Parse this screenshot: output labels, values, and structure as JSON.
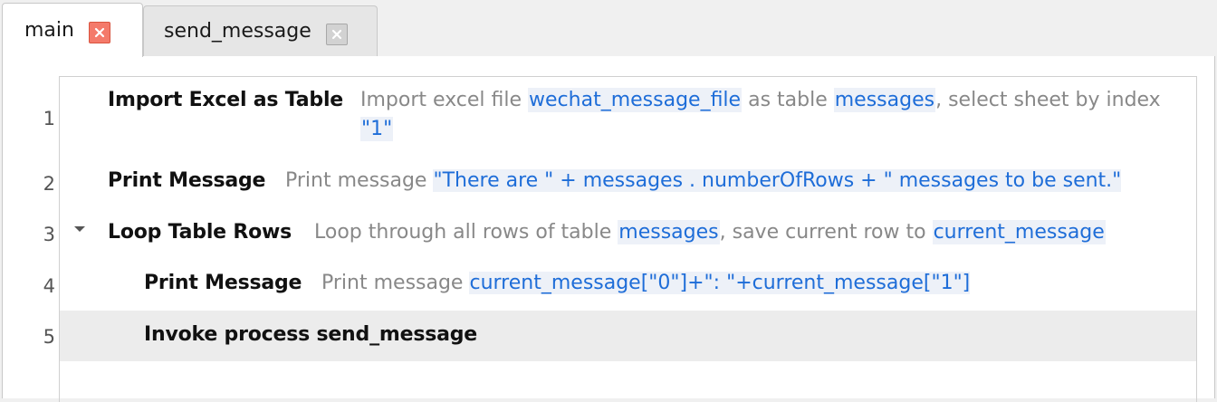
{
  "tabs": [
    {
      "label": "main",
      "active": true
    },
    {
      "label": "send_message",
      "active": false
    }
  ],
  "lines": [
    {
      "number": "1",
      "command": "Import Excel as Table",
      "desc_1": "Import excel file",
      "var_1": "wechat_message_file",
      "desc_2": "as table",
      "var_2": "messages",
      "desc_3": ", select sheet by index",
      "var_3": "\"1\""
    },
    {
      "number": "2",
      "command": "Print Message",
      "desc_1": "Print message",
      "expr": "\"There are \" + messages . numberOfRows + \" messages to be sent.\""
    },
    {
      "number": "3",
      "command": "Loop Table Rows",
      "desc_1": "Loop through all rows of table",
      "var_1": "messages",
      "desc_2": ", save current row to",
      "var_2": "current_message",
      "expanded": true
    },
    {
      "number": "4",
      "command": "Print Message",
      "desc_1": "Print message",
      "expr": "current_message[\"0\"]+\":  \"+current_message[\"1\"]"
    },
    {
      "number": "5",
      "command": "Invoke process send_message",
      "selected": true
    }
  ],
  "colors": {
    "variable": "#1e6dd8",
    "variable_bg": "#edf1f8",
    "description": "#888888",
    "selected_row": "#ececec",
    "active_close": "#f47a6a"
  },
  "icons": {
    "tab_close": "close-icon",
    "collapse": "triangle-down-icon"
  }
}
